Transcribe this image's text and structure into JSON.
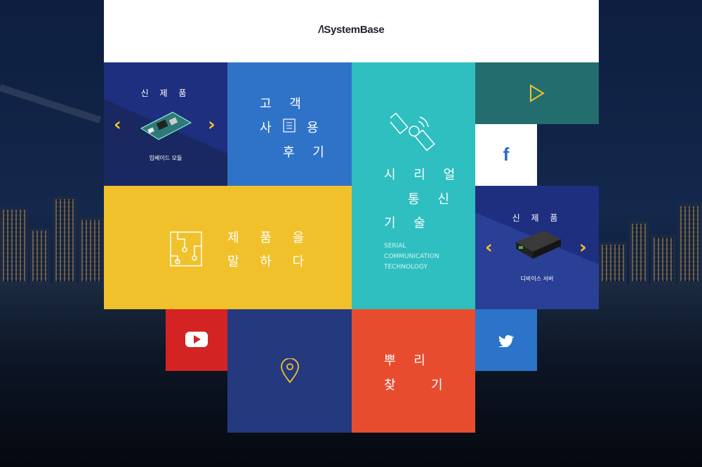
{
  "header": {
    "logo_text": "SystemBase"
  },
  "new_product_left": {
    "title": "신 제 품",
    "caption": "임베이드 모듈"
  },
  "review": {
    "line1": "고 객",
    "line2a": "사",
    "line2b": "용",
    "line3": "후 기"
  },
  "serial": {
    "line1": "시 리 얼",
    "line2": "통 신",
    "line3": "기 술",
    "en1": "SERIAL",
    "en2": "COMMUNICATION",
    "en3": "TECHNOLOGY"
  },
  "speak": {
    "line1": "제 품 을",
    "line2": "말 하 다"
  },
  "new_product_right": {
    "title": "신 제 품",
    "caption": "디바이스 서버"
  },
  "roots": {
    "line1": "뿌 리",
    "line2a": "찾",
    "line2b": "기"
  },
  "colors": {
    "navy": "#1e2f80",
    "blue": "#2f73c8",
    "teal": "#2fbfc0",
    "yellow": "#f1c12c",
    "darkteal": "#246d6e",
    "red": "#d42323",
    "orange": "#e84c2e",
    "twitter": "#2b74c9",
    "deepnavy": "#25397f"
  }
}
